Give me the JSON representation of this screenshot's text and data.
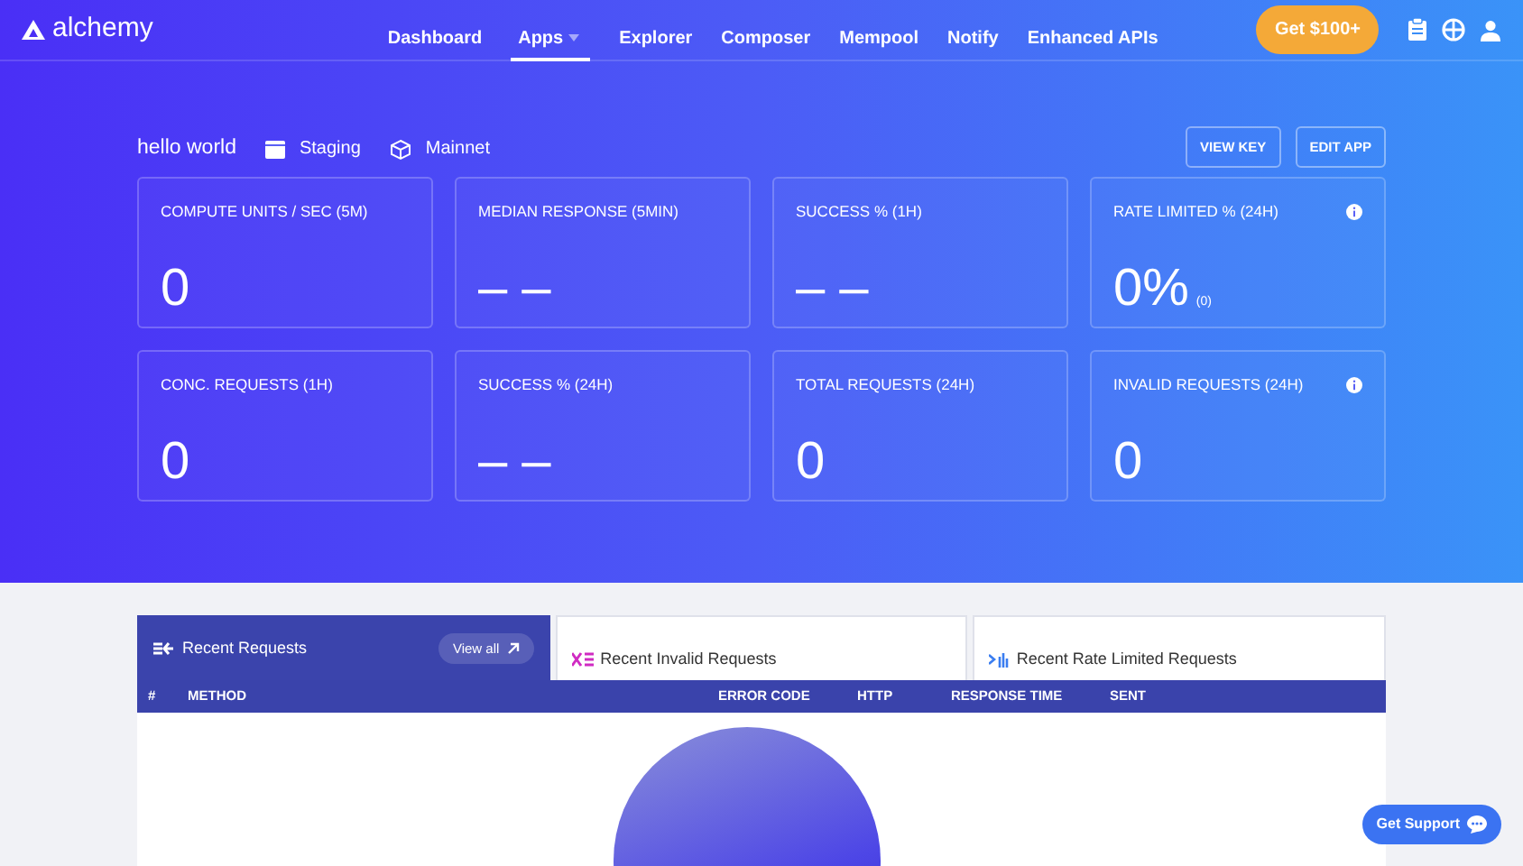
{
  "header": {
    "logo": "alchemy",
    "nav": [
      {
        "label": "Dashboard",
        "selected": false,
        "dropdown": false
      },
      {
        "label": "Apps",
        "selected": true,
        "dropdown": true
      },
      {
        "label": "Explorer",
        "selected": false,
        "dropdown": false
      },
      {
        "label": "Composer",
        "selected": false,
        "dropdown": false
      },
      {
        "label": "Mempool",
        "selected": false,
        "dropdown": false
      },
      {
        "label": "Notify",
        "selected": false,
        "dropdown": false
      },
      {
        "label": "Enhanced APIs",
        "selected": false,
        "dropdown": false
      }
    ],
    "promo_button": "Get $100+"
  },
  "app": {
    "name": "hello world",
    "tags": [
      {
        "kind": "staging",
        "label": "Staging"
      },
      {
        "kind": "network",
        "label": "Mainnet"
      }
    ],
    "buttons": [
      "VIEW KEY",
      "EDIT APP"
    ]
  },
  "metrics": [
    {
      "label": "COMPUTE UNITS / SEC (5M)",
      "value": "0",
      "info": false
    },
    {
      "label": "MEDIAN RESPONSE (5MIN)",
      "value": "– –",
      "info": false
    },
    {
      "label": "SUCCESS % (1H)",
      "value": "– –",
      "info": false
    },
    {
      "label": "RATE LIMITED % (24H)",
      "value": "0%",
      "sub": "(0)",
      "info": true
    },
    {
      "label": "CONC. REQUESTS (1H)",
      "value": "0",
      "info": false
    },
    {
      "label": "SUCCESS % (24H)",
      "value": "– –",
      "info": false
    },
    {
      "label": "TOTAL REQUESTS (24H)",
      "value": "0",
      "info": false
    },
    {
      "label": "INVALID REQUESTS (24H)",
      "value": "0",
      "info": true
    }
  ],
  "request_tabs": [
    {
      "kind": "recent",
      "label": "Recent Requests",
      "selected": true,
      "link": "View all"
    },
    {
      "kind": "invalid",
      "label": "Recent Invalid Requests",
      "selected": false
    },
    {
      "kind": "rate_limited",
      "label": "Recent Rate Limited Requests",
      "selected": false
    }
  ],
  "table": {
    "columns": [
      "#",
      "METHOD",
      "ERROR CODE",
      "HTTP",
      "RESPONSE TIME",
      "SENT"
    ]
  },
  "support_button": "Get Support"
}
